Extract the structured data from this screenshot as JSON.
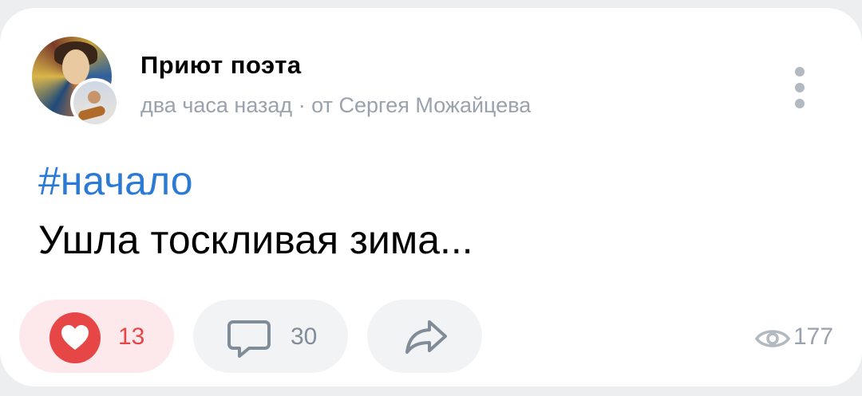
{
  "post": {
    "group_name": "Приют поэта",
    "meta": "два часа назад · от Сергея Можайцева",
    "hashtag": "#начало",
    "text": "Ушла тоскливая зима..."
  },
  "actions": {
    "likes": "13",
    "comments": "30",
    "views": "177"
  },
  "icons": {
    "more": "more-vertical-icon",
    "like": "heart-icon",
    "comment": "comment-icon",
    "share": "share-arrow-icon",
    "views": "eye-icon"
  },
  "colors": {
    "accent_link": "#2a7ad6",
    "like_red": "#e64646",
    "muted": "#99a2ad"
  }
}
